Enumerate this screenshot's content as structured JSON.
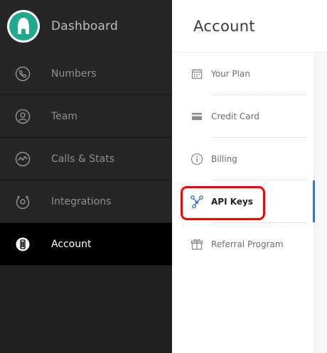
{
  "brand": {
    "title": "Dashboard",
    "logo_color": "#1fa98d"
  },
  "sidebar": {
    "items": [
      {
        "label": "Numbers",
        "icon": "phone-icon"
      },
      {
        "label": "Team",
        "icon": "user-icon"
      },
      {
        "label": "Calls & Stats",
        "icon": "stats-icon"
      },
      {
        "label": "Integrations",
        "icon": "integrations-icon"
      },
      {
        "label": "Account",
        "icon": "account-icon",
        "active": true
      }
    ]
  },
  "main": {
    "title": "Account",
    "submenu": [
      {
        "label": "Your Plan",
        "icon": "calendar-icon"
      },
      {
        "label": "Credit Card",
        "icon": "credit-card-icon"
      },
      {
        "label": "Billing",
        "icon": "info-icon"
      },
      {
        "label": "API Keys",
        "icon": "api-keys-icon",
        "active": true
      },
      {
        "label": "Referral Program",
        "icon": "gift-icon"
      }
    ]
  },
  "colors": {
    "accent": "#3a74c9",
    "highlight": "#ff0000",
    "sidebar_bg": "#262626"
  }
}
